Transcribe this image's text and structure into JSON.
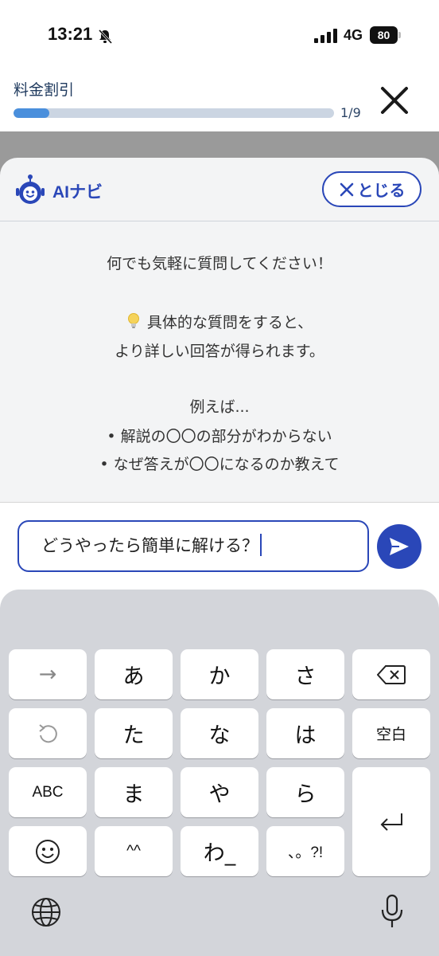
{
  "status_bar": {
    "time": "13:21",
    "network": "4G",
    "battery": "80"
  },
  "header": {
    "title": "料金割引",
    "progress_count": "1/9",
    "progress_fraction": 0.111
  },
  "sheet": {
    "title": "AIナビ",
    "close_label": "とじる",
    "lines": [
      "何でも気軽に質問してください！",
      "具体的な質問をすると、",
      "より詳しい回答が得られます。",
      "例えば...",
      "• 解説の〇〇の部分がわからない",
      "• なぜ答えが〇〇になるのか教えて"
    ]
  },
  "input": {
    "value": "どうやったら簡単に解ける？"
  },
  "keyboard": {
    "row1": [
      "→",
      "あ",
      "か",
      "さ"
    ],
    "row2": [
      "た",
      "な",
      "は",
      "空白"
    ],
    "row3": [
      "ABC",
      "ま",
      "や",
      "ら"
    ],
    "row4": [
      "^^",
      "わ_",
      "、。?!"
    ]
  },
  "colors": {
    "accent": "#2a47b8",
    "progress_fill": "#4a8fdc",
    "progress_track": "#cbd5e2",
    "keyboard_bg": "#d3d5da"
  }
}
